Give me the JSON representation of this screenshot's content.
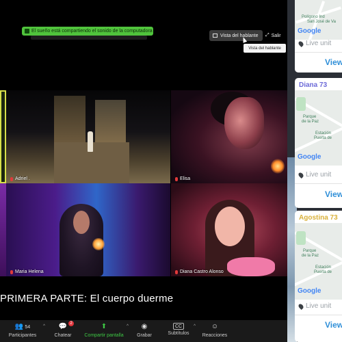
{
  "zoom": {
    "share_banner": "El sueño está compartiendo el sonido de la computadora",
    "speaker_view_button": "Vista del hablante",
    "exit_button": "Salir",
    "tooltip": "Vista del hablante",
    "participants": [
      {
        "name": "Adriel ."
      },
      {
        "name": "Elisa"
      },
      {
        "name": "Maria Helena"
      },
      {
        "name": "Diana Castro Alonso"
      }
    ],
    "caption": "PRIMERA PARTE: El cuerpo duerme",
    "toolbar": {
      "participants_label": "Participantes",
      "participants_count": "54",
      "chat_label": "Chatear",
      "chat_badge": "2",
      "share_label": "Compartir pantalla",
      "record_label": "Grabar",
      "subtitles_label": "Subtítulos",
      "subtitles_icon_text": "CC",
      "reactions_label": "Reacciones"
    }
  },
  "sidebar": {
    "cards": [
      {
        "title": "",
        "map_text": [
          "Polígono Ind",
          "San José de Va"
        ],
        "google": "Google",
        "live": "Live unit",
        "view": "View"
      },
      {
        "title": "Diana 73",
        "map_text": [
          "Parque",
          "de la Paz",
          "Estación",
          "Puerta de"
        ],
        "google": "Google",
        "live": "Live unit",
        "view": "View"
      },
      {
        "title": "Agostina 73",
        "map_text": [
          "Parque",
          "de la Paz",
          "Estación",
          "Puerta de"
        ],
        "google": "Google",
        "live": "Live unit",
        "view": "View"
      }
    ],
    "colors": {
      "title_purple": "#6c6ad8",
      "title_yellow": "#d9b13b",
      "view_blue": "#2f8fd8"
    }
  }
}
